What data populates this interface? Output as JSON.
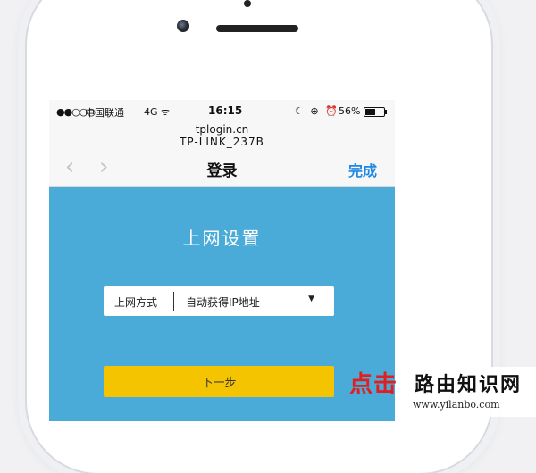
{
  "status_bar": {
    "signal": "●●○○○",
    "carrier": "中国联通",
    "network": "4G",
    "network_extra": "ᯤ",
    "time": "16:15",
    "icons": "☾ ⊕ ⏰",
    "battery": "56%",
    "battery_level": 0.56
  },
  "browser": {
    "host": "tplogin.cn",
    "page_title": "TP-LINK_237B"
  },
  "nav": {
    "back": "‹",
    "forward": "›",
    "title": "登录",
    "done": "完成"
  },
  "setup": {
    "heading": "上网设置",
    "mode_label": "上网方式",
    "mode_value": "自动获得IP地址",
    "caret": "▼",
    "next_button": "下一步"
  },
  "watermark": {
    "click_text": "点击",
    "site_name": "路由知识网",
    "site_url": "www.yilanbo.com"
  }
}
